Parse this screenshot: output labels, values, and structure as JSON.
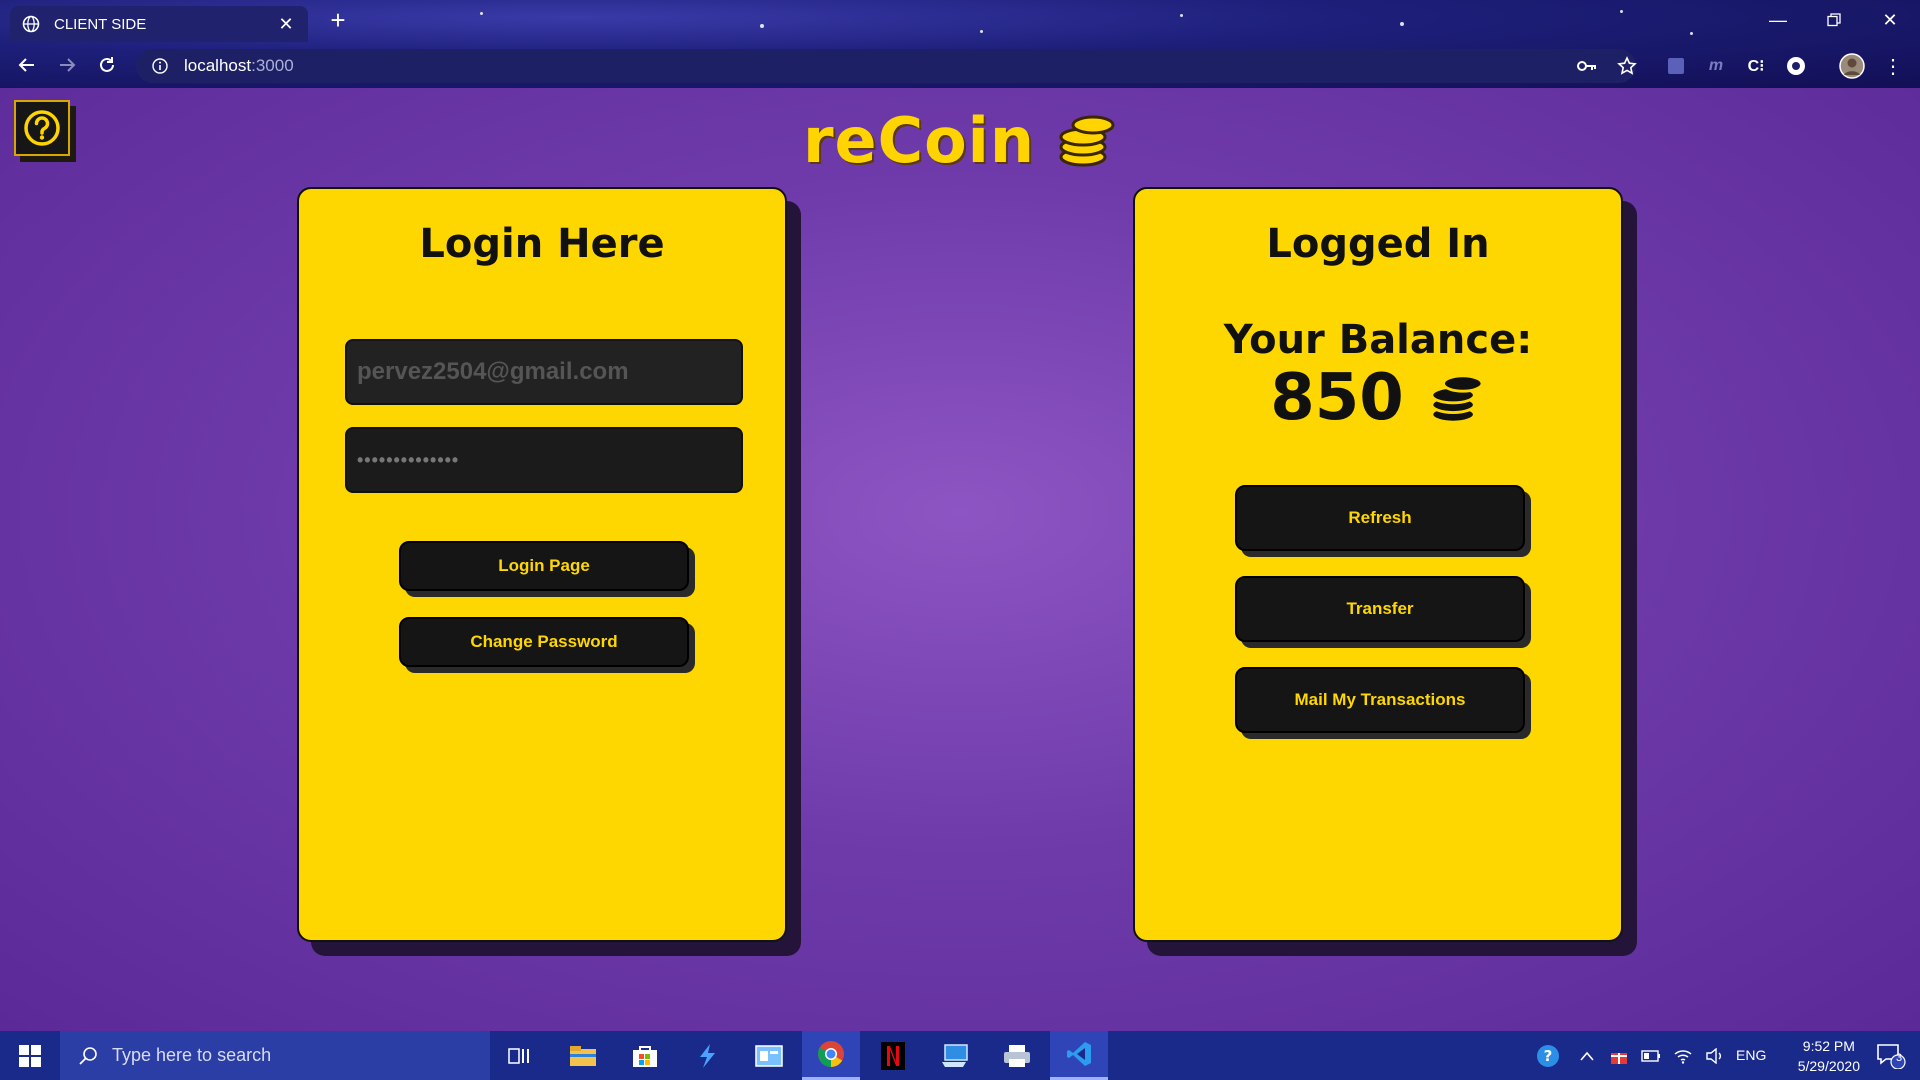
{
  "browser": {
    "tab_title": "CLIENT SIDE",
    "url_host": "localhost",
    "url_port": ":3000"
  },
  "brand": {
    "name": "reCoin",
    "color": "#ffd400"
  },
  "login_card": {
    "heading": "Login Here",
    "email_value": "pervez2504@gmail.com",
    "password_mask": "••••••••••••••",
    "login_button": "Login Page",
    "change_password_button": "Change Password"
  },
  "account_card": {
    "heading": "Logged In",
    "balance_label": "Your Balance:",
    "balance_value": "850",
    "refresh_button": "Refresh",
    "transfer_button": "Transfer",
    "mail_button": "Mail My Transactions"
  },
  "taskbar": {
    "search_placeholder": "Type here to search",
    "language": "ENG",
    "time": "9:52 PM",
    "date": "5/29/2020",
    "notification_count": "3"
  },
  "colors": {
    "card": "#ffd700",
    "button": "#151515",
    "button_text": "#ffd700",
    "page_bg": "#7a45b4"
  }
}
